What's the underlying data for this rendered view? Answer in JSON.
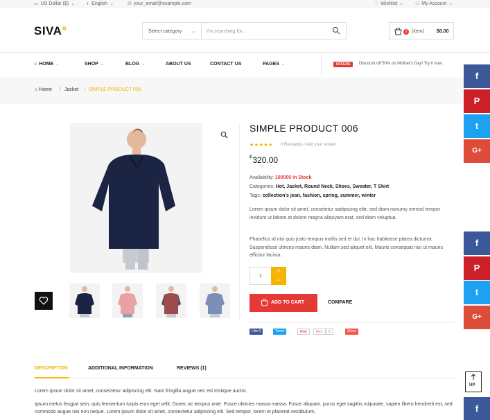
{
  "topbar": {
    "currency": "US Dollar ($)",
    "language": "English",
    "email": "your_email@example.com",
    "wishlist": "Wishlist",
    "account": "My Account"
  },
  "header": {
    "logo": "SIVA",
    "search_category": "Select category",
    "search_placeholder": "I'm searching for...",
    "cart_count": "0",
    "cart_label": "(item)",
    "cart_total": "$0.00"
  },
  "nav": {
    "items": [
      "HOME",
      "SHOP",
      "BLOG",
      "ABOUT US",
      "CONTACT US",
      "PAGES"
    ],
    "offer_badge": "OFFERS",
    "offer_text": "Discount off 50% on Mother's Day! Try it now."
  },
  "breadcrumb": {
    "home": "Home",
    "category": "Jacket",
    "current": "SIMPLE PRODUCT 006"
  },
  "product": {
    "title": "SIMPLE PRODUCT 006",
    "stars": "★★★★★",
    "reviews": "0 Review(s) / Add your review",
    "currency_symbol": "$",
    "price": "320.00",
    "availability_label": "Availability:",
    "availability_value": "100000 In Stock",
    "categories_label": "Categories:",
    "categories_value": "Hot, Jacket, Round Neck, Shoes, Sweater, T Shirt",
    "tags_label": "Tags:",
    "tags_value": "collection's jean, fashion, spring, summer, winter",
    "desc1": "Lorem ipsum dolor sit amet, consetetur sadipscing elitr, sed diam nonumy eirmod tempor invidunt ut labore et dolore magna aliquyam erat, sed diam voluptua.",
    "desc2": "Phasellus id nisi quis justo tempus mollis sed et dui. In hac habitasse platea dictumst. Suspendisse ultrices mauris diam. Nullam sed aliquet elit. Mauris consequat nisi ut mauris efficitur lacinia.",
    "quantity": "1",
    "plus": "+",
    "minus": "−",
    "add_to_cart": "ADD TO CART",
    "compare": "COMPARE"
  },
  "share": {
    "like": "Like 0",
    "tweet": "Tweet",
    "pin": "Pinit",
    "gplus": "G+1",
    "gcount": "0",
    "share": "Share"
  },
  "tabs": {
    "description": "DESCRIPTION",
    "additional": "ADDITIONAL INFORMATION",
    "reviews": "REVIEWS (1)",
    "line1": "Lorem ipsum dolor sit amet, consectetur adipiscing elit. Nam fringilla augue nec est tristique auctor.",
    "line2": "Ipsum metus feugiat sem, quis fermentum turpis eros eget velit. Donec ac tempus ante. Fusce ultricies massa massa. Fusce aliquam, purus eget sagittis vulputate, sapien libero hendrerit est, sed commodo augue nisi non neque. Lorem ipsum dolor sit amet, consectetur adipiscing elit. Sed tempor, lorem et placerat vestibulum,"
  },
  "social": {
    "facebook": "f",
    "pinterest": "P",
    "twitter": "t",
    "googleplus": "G+"
  },
  "scroll_top": "UP",
  "colors": {
    "accent": "#f4b400",
    "red": "#e53935",
    "facebook": "#3b5998",
    "pinterest": "#cb2027",
    "twitter": "#1da1f2",
    "googleplus": "#dd4b39"
  }
}
